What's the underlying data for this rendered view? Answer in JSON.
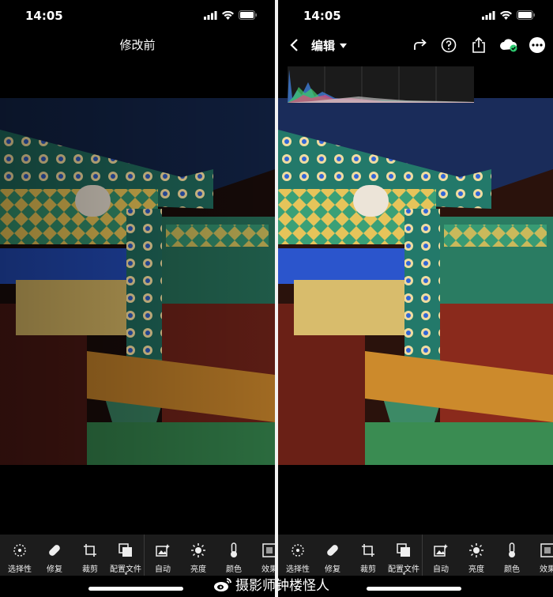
{
  "status": {
    "time": "14:05"
  },
  "left": {
    "title": "修改前"
  },
  "right": {
    "title": "编辑"
  },
  "tools": [
    {
      "label": "选择性",
      "icon": "selective-icon"
    },
    {
      "label": "修复",
      "icon": "heal-bandage-icon"
    },
    {
      "label": "裁剪",
      "icon": "crop-icon"
    },
    {
      "label": "配置文件",
      "icon": "profiles-icon"
    },
    {
      "label": "自动",
      "icon": "auto-icon"
    },
    {
      "label": "亮度",
      "icon": "brightness-sun-icon"
    },
    {
      "label": "颜色",
      "icon": "color-thermometer-icon"
    },
    {
      "label": "效果",
      "icon": "effects-icon"
    }
  ],
  "watermark": {
    "text": "摄影师钟楼怪人"
  },
  "colors": {
    "background": "#000000",
    "toolbar": "#1c1c1c",
    "divider": "#f2f2f2",
    "sync_check": "#2ecc71"
  }
}
